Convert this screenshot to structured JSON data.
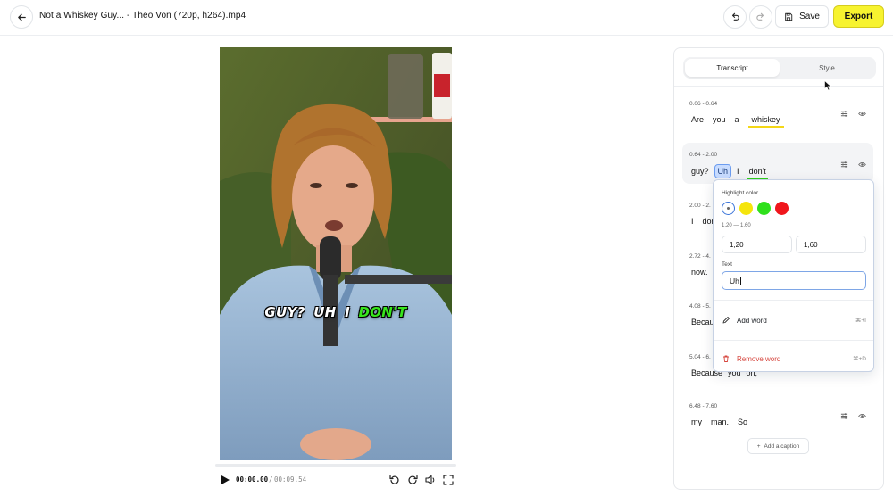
{
  "header": {
    "file_title": "Not a Whiskey Guy... - Theo Von (720p, h264).mp4",
    "save_label": "Save",
    "export_label": "Export",
    "colors": {
      "export_bg": "#f7f32f"
    }
  },
  "player": {
    "caption_words": [
      "GUY?",
      "UH",
      "I",
      "DON'T"
    ],
    "active_word": "DON'T",
    "time_current": "00:00.00",
    "time_sep": "/",
    "time_total": "00:09.54",
    "progress": 0
  },
  "panel": {
    "tabs": [
      {
        "label": "Transcript",
        "active": true
      },
      {
        "label": "Style",
        "active": false
      }
    ],
    "segments": [
      {
        "time": "0.06 - 0.64",
        "words": [
          "Are",
          "you",
          "a",
          "whiskey"
        ]
      },
      {
        "time": "0.64 - 2.00",
        "words": [
          "guy?",
          "Uh",
          "I",
          "don't"
        ]
      },
      {
        "time": "2.00 - 2.",
        "words": [
          "I",
          "don"
        ]
      },
      {
        "time": "2.72 - 4.",
        "words": [
          "now."
        ]
      },
      {
        "time": "4.08 - 5.",
        "words": [
          "Becau"
        ]
      },
      {
        "time": "5.04 - 6.",
        "words": [
          "Because",
          "you",
          "oh,"
        ]
      },
      {
        "time": "6.48 - 7.60",
        "words": [
          "my",
          "man.",
          "So"
        ]
      }
    ],
    "add_caption_label": "Add a caption"
  },
  "popover": {
    "highlight_label": "Highlight color",
    "swatches": [
      {
        "name": "none",
        "color": "#ffffff",
        "selected": true
      },
      {
        "name": "yellow",
        "color": "#f5e50c"
      },
      {
        "name": "green",
        "color": "#2fe01c"
      },
      {
        "name": "red",
        "color": "#f0161c"
      }
    ],
    "range": "1.20 — 1.60",
    "start_value": "1,20",
    "end_value": "1,60",
    "text_label": "Text",
    "text_value": "Uh",
    "add_word_label": "Add word",
    "add_word_shortcut": "⌘+I",
    "remove_word_label": "Remove word",
    "remove_word_shortcut": "⌘+D"
  }
}
